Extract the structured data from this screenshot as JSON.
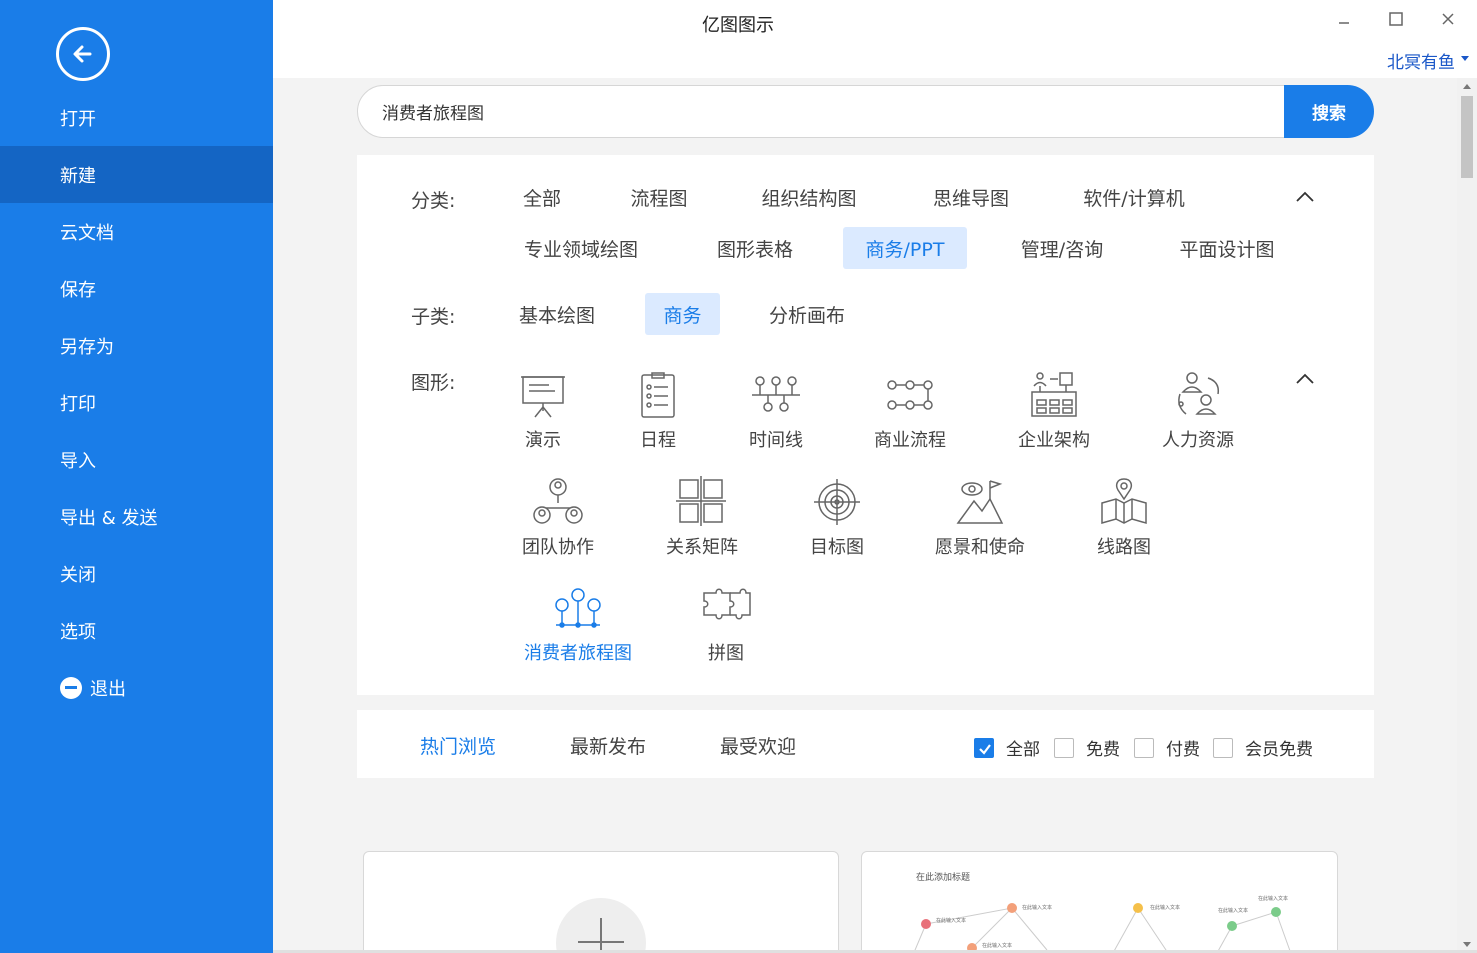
{
  "app": {
    "title": "亿图图示",
    "user_name": "北冥有鱼"
  },
  "colors": {
    "sidebar": "#1a7de8",
    "sidebar_active": "#1465c4",
    "accent": "#1a7de8",
    "chip_active_bg": "#dbeaff"
  },
  "sidebar": {
    "items": [
      {
        "label": "打开"
      },
      {
        "label": "新建",
        "active": true
      },
      {
        "label": "云文档"
      },
      {
        "label": "保存"
      },
      {
        "label": "另存为"
      },
      {
        "label": "打印"
      },
      {
        "label": "导入"
      },
      {
        "label": "导出 & 发送"
      },
      {
        "label": "关闭"
      },
      {
        "label": "选项"
      },
      {
        "label": "退出",
        "icon": "minus-circle-icon"
      }
    ]
  },
  "search": {
    "value": "消费者旅程图",
    "button_label": "搜索"
  },
  "filters": {
    "category_label": "分类:",
    "categories": [
      "全部",
      "流程图",
      "组织结构图",
      "思维导图",
      "软件/计算机",
      "专业领域绘图",
      "图形表格",
      "商务/PPT",
      "管理/咨询",
      "平面设计图"
    ],
    "active_category": "商务/PPT",
    "subcategory_label": "子类:",
    "subcategories": [
      "基本绘图",
      "商务",
      "分析画布"
    ],
    "active_subcategory": "商务",
    "shape_label": "图形:",
    "shapes": [
      {
        "label": "演示",
        "icon": "presentation-board-icon"
      },
      {
        "label": "日程",
        "icon": "checklist-icon"
      },
      {
        "label": "时间线",
        "icon": "timeline-icon"
      },
      {
        "label": "商业流程",
        "icon": "business-process-icon"
      },
      {
        "label": "企业架构",
        "icon": "enterprise-architecture-icon"
      },
      {
        "label": "人力资源",
        "icon": "human-resources-icon"
      },
      {
        "label": "团队协作",
        "icon": "team-collaboration-icon"
      },
      {
        "label": "关系矩阵",
        "icon": "matrix-icon"
      },
      {
        "label": "目标图",
        "icon": "target-icon"
      },
      {
        "label": "愿景和使命",
        "icon": "vision-mission-icon"
      },
      {
        "label": "线路图",
        "icon": "route-map-icon"
      },
      {
        "label": "消费者旅程图",
        "icon": "customer-journey-icon",
        "active": true
      },
      {
        "label": "拼图",
        "icon": "puzzle-icon"
      }
    ]
  },
  "tabs": {
    "items": [
      "热门浏览",
      "最新发布",
      "最受欢迎"
    ],
    "active": "热门浏览"
  },
  "price_filters": [
    {
      "label": "全部",
      "checked": true
    },
    {
      "label": "免费",
      "checked": false
    },
    {
      "label": "付费",
      "checked": false
    },
    {
      "label": "会员免费",
      "checked": false
    }
  ],
  "template_preview": {
    "title": "在此添加标题",
    "node_text": "在此输入文本"
  }
}
